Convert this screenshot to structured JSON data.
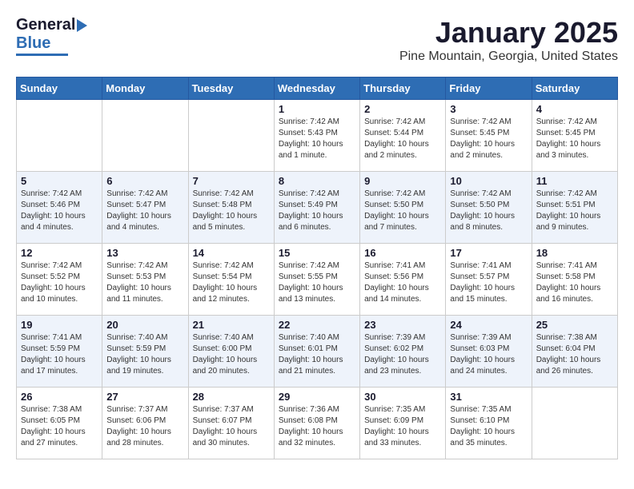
{
  "header": {
    "logo_general": "General",
    "logo_blue": "Blue",
    "month_title": "January 2025",
    "location": "Pine Mountain, Georgia, United States"
  },
  "days_of_week": [
    "Sunday",
    "Monday",
    "Tuesday",
    "Wednesday",
    "Thursday",
    "Friday",
    "Saturday"
  ],
  "weeks": [
    [
      {
        "day": "",
        "content": ""
      },
      {
        "day": "",
        "content": ""
      },
      {
        "day": "",
        "content": ""
      },
      {
        "day": "1",
        "content": "Sunrise: 7:42 AM\nSunset: 5:43 PM\nDaylight: 10 hours\nand 1 minute."
      },
      {
        "day": "2",
        "content": "Sunrise: 7:42 AM\nSunset: 5:44 PM\nDaylight: 10 hours\nand 2 minutes."
      },
      {
        "day": "3",
        "content": "Sunrise: 7:42 AM\nSunset: 5:45 PM\nDaylight: 10 hours\nand 2 minutes."
      },
      {
        "day": "4",
        "content": "Sunrise: 7:42 AM\nSunset: 5:45 PM\nDaylight: 10 hours\nand 3 minutes."
      }
    ],
    [
      {
        "day": "5",
        "content": "Sunrise: 7:42 AM\nSunset: 5:46 PM\nDaylight: 10 hours\nand 4 minutes."
      },
      {
        "day": "6",
        "content": "Sunrise: 7:42 AM\nSunset: 5:47 PM\nDaylight: 10 hours\nand 4 minutes."
      },
      {
        "day": "7",
        "content": "Sunrise: 7:42 AM\nSunset: 5:48 PM\nDaylight: 10 hours\nand 5 minutes."
      },
      {
        "day": "8",
        "content": "Sunrise: 7:42 AM\nSunset: 5:49 PM\nDaylight: 10 hours\nand 6 minutes."
      },
      {
        "day": "9",
        "content": "Sunrise: 7:42 AM\nSunset: 5:50 PM\nDaylight: 10 hours\nand 7 minutes."
      },
      {
        "day": "10",
        "content": "Sunrise: 7:42 AM\nSunset: 5:50 PM\nDaylight: 10 hours\nand 8 minutes."
      },
      {
        "day": "11",
        "content": "Sunrise: 7:42 AM\nSunset: 5:51 PM\nDaylight: 10 hours\nand 9 minutes."
      }
    ],
    [
      {
        "day": "12",
        "content": "Sunrise: 7:42 AM\nSunset: 5:52 PM\nDaylight: 10 hours\nand 10 minutes."
      },
      {
        "day": "13",
        "content": "Sunrise: 7:42 AM\nSunset: 5:53 PM\nDaylight: 10 hours\nand 11 minutes."
      },
      {
        "day": "14",
        "content": "Sunrise: 7:42 AM\nSunset: 5:54 PM\nDaylight: 10 hours\nand 12 minutes."
      },
      {
        "day": "15",
        "content": "Sunrise: 7:42 AM\nSunset: 5:55 PM\nDaylight: 10 hours\nand 13 minutes."
      },
      {
        "day": "16",
        "content": "Sunrise: 7:41 AM\nSunset: 5:56 PM\nDaylight: 10 hours\nand 14 minutes."
      },
      {
        "day": "17",
        "content": "Sunrise: 7:41 AM\nSunset: 5:57 PM\nDaylight: 10 hours\nand 15 minutes."
      },
      {
        "day": "18",
        "content": "Sunrise: 7:41 AM\nSunset: 5:58 PM\nDaylight: 10 hours\nand 16 minutes."
      }
    ],
    [
      {
        "day": "19",
        "content": "Sunrise: 7:41 AM\nSunset: 5:59 PM\nDaylight: 10 hours\nand 17 minutes."
      },
      {
        "day": "20",
        "content": "Sunrise: 7:40 AM\nSunset: 5:59 PM\nDaylight: 10 hours\nand 19 minutes."
      },
      {
        "day": "21",
        "content": "Sunrise: 7:40 AM\nSunset: 6:00 PM\nDaylight: 10 hours\nand 20 minutes."
      },
      {
        "day": "22",
        "content": "Sunrise: 7:40 AM\nSunset: 6:01 PM\nDaylight: 10 hours\nand 21 minutes."
      },
      {
        "day": "23",
        "content": "Sunrise: 7:39 AM\nSunset: 6:02 PM\nDaylight: 10 hours\nand 23 minutes."
      },
      {
        "day": "24",
        "content": "Sunrise: 7:39 AM\nSunset: 6:03 PM\nDaylight: 10 hours\nand 24 minutes."
      },
      {
        "day": "25",
        "content": "Sunrise: 7:38 AM\nSunset: 6:04 PM\nDaylight: 10 hours\nand 26 minutes."
      }
    ],
    [
      {
        "day": "26",
        "content": "Sunrise: 7:38 AM\nSunset: 6:05 PM\nDaylight: 10 hours\nand 27 minutes."
      },
      {
        "day": "27",
        "content": "Sunrise: 7:37 AM\nSunset: 6:06 PM\nDaylight: 10 hours\nand 28 minutes."
      },
      {
        "day": "28",
        "content": "Sunrise: 7:37 AM\nSunset: 6:07 PM\nDaylight: 10 hours\nand 30 minutes."
      },
      {
        "day": "29",
        "content": "Sunrise: 7:36 AM\nSunset: 6:08 PM\nDaylight: 10 hours\nand 32 minutes."
      },
      {
        "day": "30",
        "content": "Sunrise: 7:35 AM\nSunset: 6:09 PM\nDaylight: 10 hours\nand 33 minutes."
      },
      {
        "day": "31",
        "content": "Sunrise: 7:35 AM\nSunset: 6:10 PM\nDaylight: 10 hours\nand 35 minutes."
      },
      {
        "day": "",
        "content": ""
      }
    ]
  ]
}
